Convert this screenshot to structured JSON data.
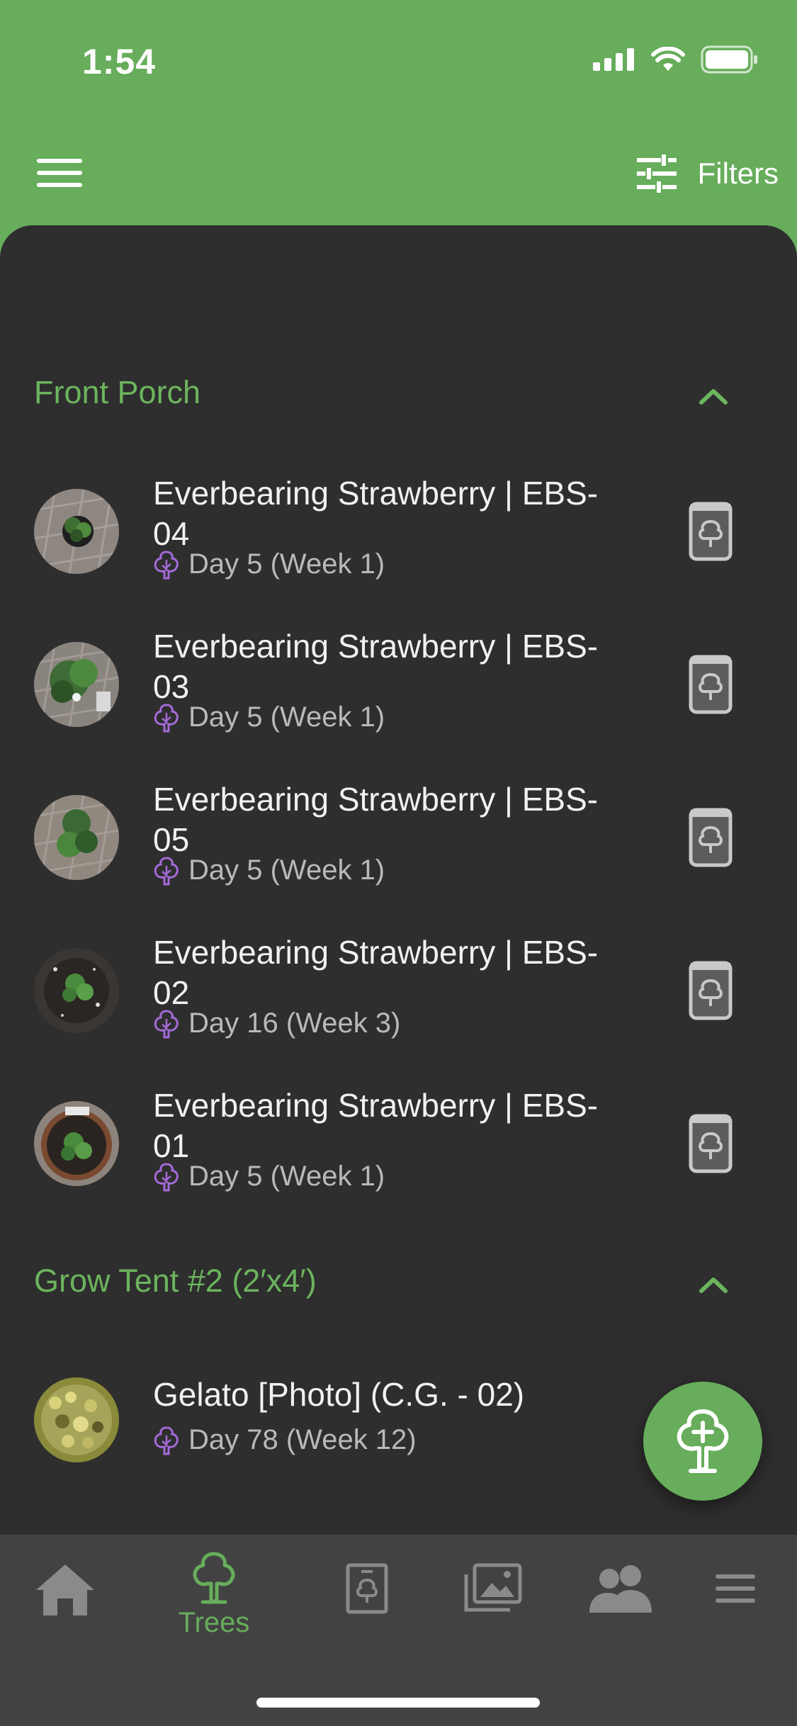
{
  "status_bar": {
    "time": "1:54"
  },
  "header": {
    "filters_label": "Filters"
  },
  "sections": [
    {
      "title": "Front Porch",
      "items": [
        {
          "title": "Everbearing Strawberry | EBS-04",
          "subtitle": "Day 5 (Week 1)"
        },
        {
          "title": "Everbearing Strawberry | EBS-03",
          "subtitle": "Day 5 (Week 1)"
        },
        {
          "title": "Everbearing Strawberry | EBS-05",
          "subtitle": "Day 5 (Week 1)"
        },
        {
          "title": "Everbearing Strawberry | EBS-02",
          "subtitle": "Day 16 (Week 3)"
        },
        {
          "title": "Everbearing Strawberry | EBS-01",
          "subtitle": "Day 5 (Week 1)"
        }
      ]
    },
    {
      "title": "Grow Tent #2 (2′x4′)",
      "items": [
        {
          "title": "Gelato [Photo] (C.G. - 02)",
          "subtitle": "Day 78 (Week 12)"
        }
      ]
    }
  ],
  "bottom_nav": {
    "items": [
      {
        "icon": "home-icon",
        "label": ""
      },
      {
        "icon": "tree-icon",
        "label": "Trees",
        "active": true
      },
      {
        "icon": "diary-icon",
        "label": ""
      },
      {
        "icon": "gallery-icon",
        "label": ""
      },
      {
        "icon": "community-icon",
        "label": ""
      },
      {
        "icon": "more-menu-icon",
        "label": ""
      }
    ]
  },
  "colors": {
    "accent": "#67ad5b",
    "background": "#2e2e2e",
    "nav_background": "#424242",
    "stage_icon": "#a46ad8"
  }
}
